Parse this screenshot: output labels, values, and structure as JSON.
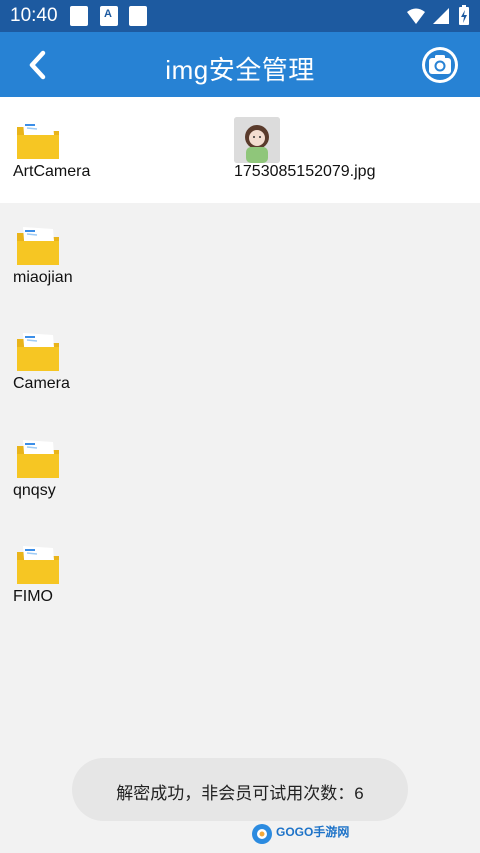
{
  "status_bar": {
    "time": "10:40"
  },
  "app_bar": {
    "title": "img安全管理"
  },
  "files": [
    {
      "name": "ArtCamera",
      "type": "folder"
    },
    {
      "name": "1753085152079.jpg",
      "type": "image"
    },
    {
      "name": "miaojian",
      "type": "folder"
    },
    {
      "name": "Camera",
      "type": "folder"
    },
    {
      "name": "qnqsy",
      "type": "folder"
    },
    {
      "name": "FIMO",
      "type": "folder"
    }
  ],
  "toast": {
    "message": "解密成功，非会员可试用次数：6"
  },
  "watermark": {
    "brand": "GOGO手游网"
  },
  "colors": {
    "status_bar": "#1d5aa0",
    "app_bar": "#2782d4",
    "folder": "#f6c623"
  }
}
